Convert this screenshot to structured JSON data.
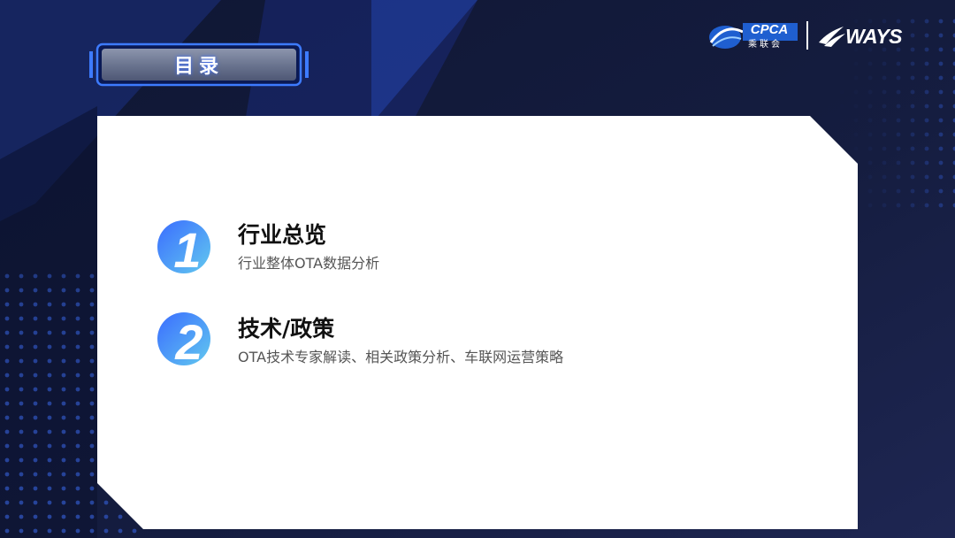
{
  "header": {
    "title": "目录"
  },
  "logos": {
    "cpca_text": "CPCA",
    "cpca_subtext": "乘联会",
    "ways_text": "WAYS"
  },
  "agenda": {
    "items": [
      {
        "number": "1",
        "title": "行业总览",
        "subtitle": "行业整体OTA数据分析"
      },
      {
        "number": "2",
        "title": "技术/政策",
        "subtitle": "OTA技术专家解读、相关政策分析、车联网运营策略"
      }
    ]
  },
  "colors": {
    "background_dark": "#121a3a",
    "accent_blue": "#3a6cff",
    "panel_white": "#ffffff",
    "number_gradient_start": "#3a7bff",
    "number_gradient_end": "#5ec8f0"
  }
}
